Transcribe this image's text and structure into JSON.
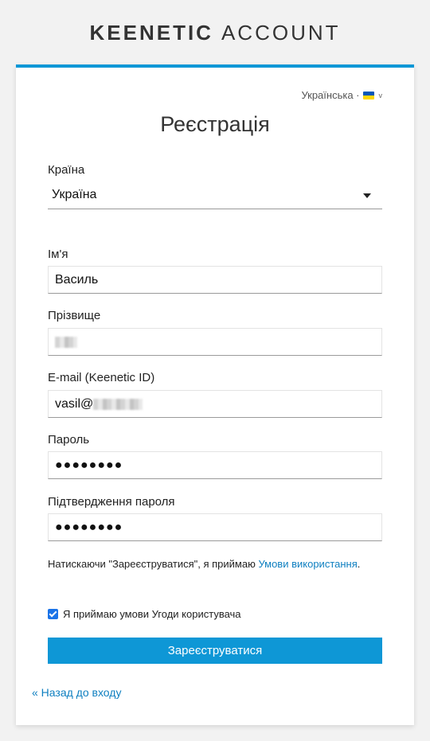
{
  "brand": {
    "name": "KEENETIC",
    "product": "ACCOUNT"
  },
  "language": {
    "label": "Українська ·",
    "flag_icon": "ukraine-flag-icon"
  },
  "page_title": "Реєстрація",
  "form": {
    "country": {
      "label": "Країна",
      "value": "Україна"
    },
    "first_name": {
      "label": "Ім'я",
      "value": "Василь"
    },
    "last_name": {
      "label": "Прізвище",
      "value": ""
    },
    "email": {
      "label": "E-mail (Keenetic ID)",
      "value": "vasil@"
    },
    "password": {
      "label": "Пароль",
      "value": "●●●●●●●●"
    },
    "password_confirm": {
      "label": "Підтвердження пароля",
      "value": "●●●●●●●●"
    }
  },
  "terms": {
    "text": "Натискаючи \"Зареєструватися\", я приймаю ",
    "link": "Умови використання",
    "end": "."
  },
  "agreement": {
    "label": "Я приймаю умови Угоди користувача",
    "checked": true
  },
  "submit_label": "Зареєструватися",
  "back_link": "« Назад до входу",
  "colors": {
    "accent": "#0e97d6",
    "link": "#0e7fc0",
    "background": "#f2f2f2"
  }
}
